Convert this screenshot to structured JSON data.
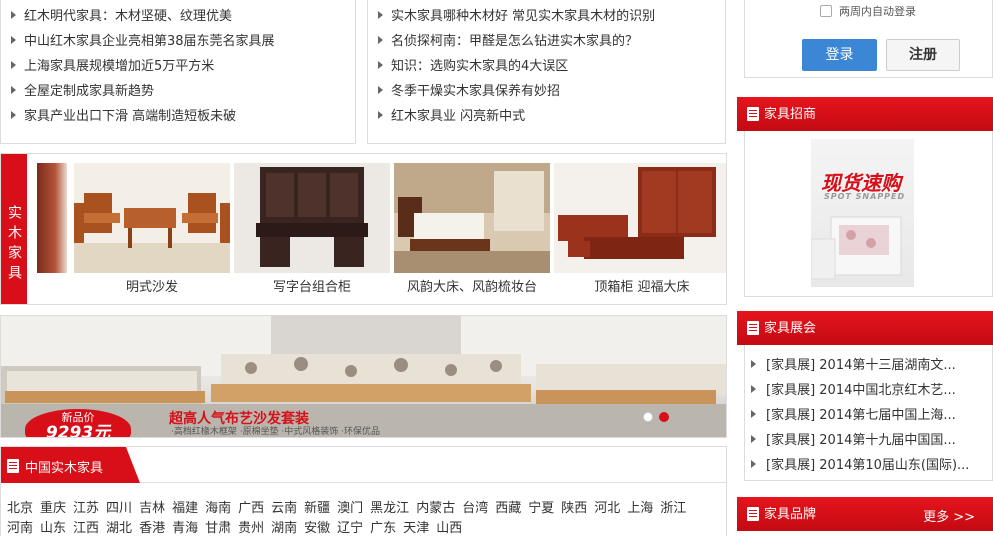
{
  "news_left": [
    "红木明代家具：木材坚硬、纹理优美",
    "中山红木家具企业亮相第38届东莞名家具展",
    "上海家具展规模增加近5万平方米",
    "全屋定制成家具新趋势",
    "家具产业出口下滑 高端制造短板未破"
  ],
  "news_right": [
    "实木家具哪种木材好 常见实木家具木材的识别",
    "名侦探柯南：甲醛是怎么钻进实木家具的？",
    "知识：选购实木家具的4大误区",
    "冬季干燥实木家具保养有妙招",
    "红木家具业 闪亮新中式"
  ],
  "products": {
    "side_tab": "实木家具",
    "items": [
      {
        "name": "明式沙发"
      },
      {
        "name": "写字台组合柜"
      },
      {
        "name": "风韵大床、风韵梳妆台"
      },
      {
        "name": "顶箱柜 迎福大床"
      }
    ]
  },
  "banner": {
    "price_label": "新品价",
    "price_value": "9293元",
    "slogan": "超高人气布艺沙发套装",
    "subline": "·高档红椽木框架   ·原棉坐垫   ·中式风格装饰   ·环保优品"
  },
  "china_furniture": {
    "title": "中国实木家具",
    "regions": [
      "北京",
      "重庆",
      "江苏",
      "四川",
      "吉林",
      "福建",
      "海南",
      "广西",
      "云南",
      "新疆",
      "澳门",
      "黑龙江",
      "内蒙古",
      "台湾",
      "西藏",
      "宁夏",
      "陕西",
      "河北",
      "上海",
      "浙江",
      "河南",
      "山东",
      "江西",
      "湖北",
      "香港",
      "青海",
      "甘肃",
      "贵州",
      "湖南",
      "安徽",
      "辽宁",
      "广东",
      "天津",
      "山西"
    ]
  },
  "login": {
    "auto_login": "两周内自动登录",
    "login_label": "登录",
    "register_label": "注册"
  },
  "recruit": {
    "title": "家具招商",
    "ad_title": "现货速购",
    "ad_sub": "SPOT SNAPPED"
  },
  "fairs": {
    "title": "家具展会",
    "items": [
      "[家具展]  2014第十三届湖南文...",
      "[家具展]  2014中国北京红木艺...",
      "[家具展]  2014第七届中国上海...",
      "[家具展]  2014第十九届中国国...",
      "[家具展]  2014第10届山东(国际)..."
    ]
  },
  "brands": {
    "title": "家具品牌",
    "more_label": "更多 >>"
  },
  "colors": {
    "accent_red": "#d80f18",
    "button_blue": "#3c86d6"
  }
}
